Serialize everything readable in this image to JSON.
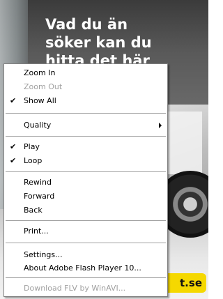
{
  "banner": {
    "headline": [
      "Vad du än",
      "söker kan du",
      "hitta det här"
    ],
    "cta_text": "t.se"
  },
  "context_menu": {
    "items": [
      {
        "label": "Zoom In",
        "checked": false,
        "disabled": false
      },
      {
        "label": "Zoom Out",
        "checked": false,
        "disabled": true
      },
      {
        "label": "Show All",
        "checked": true,
        "disabled": false
      },
      {
        "label": "Quality",
        "checked": false,
        "disabled": false,
        "submenu": true
      },
      {
        "label": "Play",
        "checked": true,
        "disabled": false
      },
      {
        "label": "Loop",
        "checked": true,
        "disabled": false
      },
      {
        "label": "Rewind",
        "checked": false,
        "disabled": false
      },
      {
        "label": "Forward",
        "checked": false,
        "disabled": false
      },
      {
        "label": "Back",
        "checked": false,
        "disabled": false
      },
      {
        "label": "Print...",
        "checked": false,
        "disabled": false
      },
      {
        "label": "Settings...",
        "checked": false,
        "disabled": false
      },
      {
        "label": "About Adobe Flash Player 10...",
        "checked": false,
        "disabled": false
      },
      {
        "label": "Download FLV by WinAVI...",
        "checked": false,
        "disabled": true
      }
    ],
    "check_glyph": "✔"
  },
  "colors": {
    "cta_yellow": "#f5d800",
    "menu_bg": "#ffffff",
    "disabled_text": "#a0a0a0"
  }
}
